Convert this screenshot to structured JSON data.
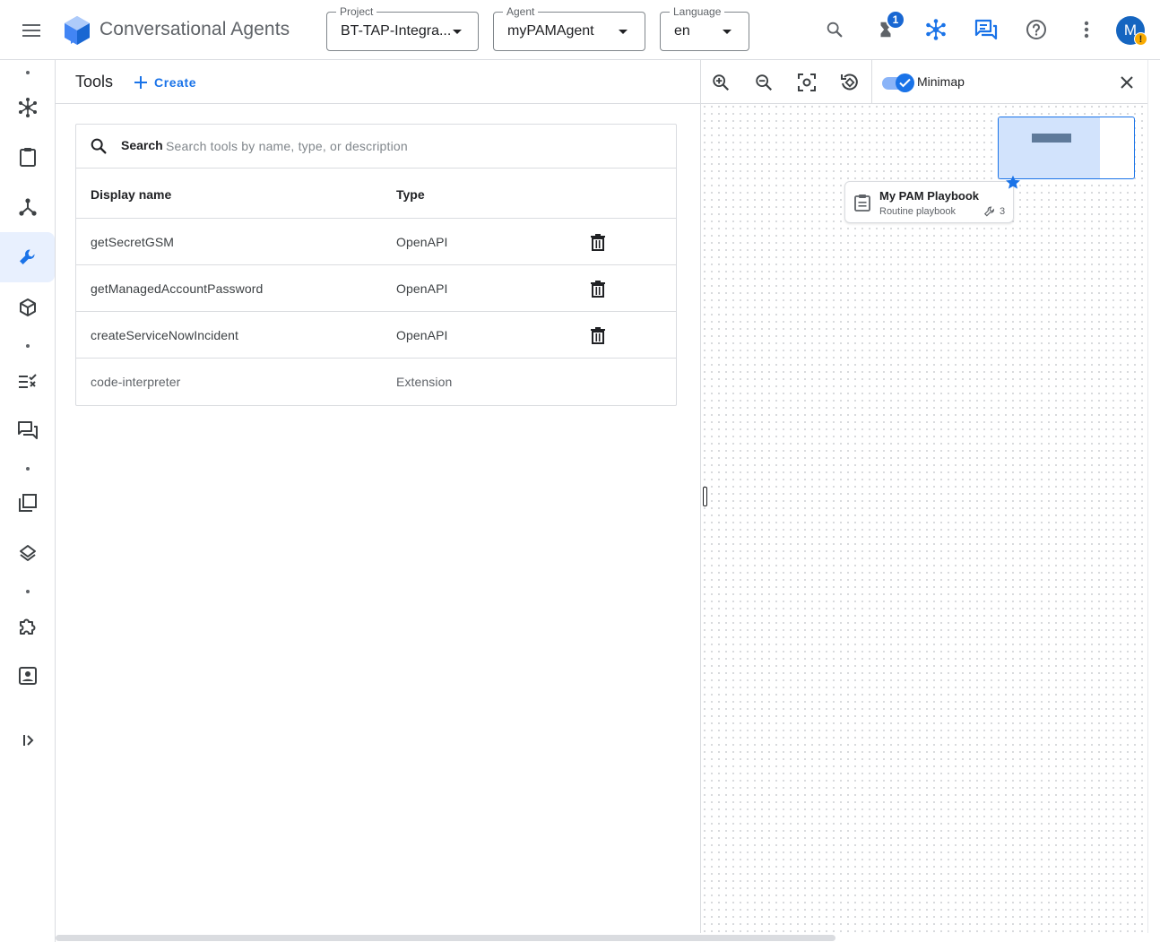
{
  "app": {
    "title": "Conversational Agents"
  },
  "header": {
    "project": {
      "label": "Project",
      "value": "BT-TAP-Integra..."
    },
    "agent": {
      "label": "Agent",
      "value": "myPAMAgent"
    },
    "language": {
      "label": "Language",
      "value": "en"
    },
    "notification_count": "1",
    "avatar_initial": "M",
    "avatar_warning": "!"
  },
  "tools": {
    "title": "Tools",
    "create_label": "Create",
    "search": {
      "label": "Search",
      "placeholder": "Search tools by name, type, or description"
    },
    "columns": {
      "display_name": "Display name",
      "type": "Type"
    },
    "rows": [
      {
        "name": "getSecretGSM",
        "type": "OpenAPI",
        "deletable": true
      },
      {
        "name": "getManagedAccountPassword",
        "type": "OpenAPI",
        "deletable": true
      },
      {
        "name": "createServiceNowIncident",
        "type": "OpenAPI",
        "deletable": true
      },
      {
        "name": "code-interpreter",
        "type": "Extension",
        "deletable": false
      }
    ]
  },
  "canvas": {
    "minimap_label": "Minimap",
    "minimap_enabled": true,
    "playbook": {
      "title": "My PAM Playbook",
      "subtitle": "Routine playbook",
      "tool_count": "3"
    }
  },
  "colors": {
    "accent": "#1a73e8",
    "active_nav_bg": "#e8f0fe",
    "avatar": "#1565c0",
    "warning": "#f9ab00"
  },
  "icons": {
    "left_nav": [
      "playbooks-icon",
      "flows-icon",
      "tools-icon",
      "examples-icon",
      "evaluations-icon",
      "conversation-history-icon",
      "data-stores-icon",
      "generators-icon",
      "integrations-icon",
      "agent-settings-icon"
    ]
  }
}
